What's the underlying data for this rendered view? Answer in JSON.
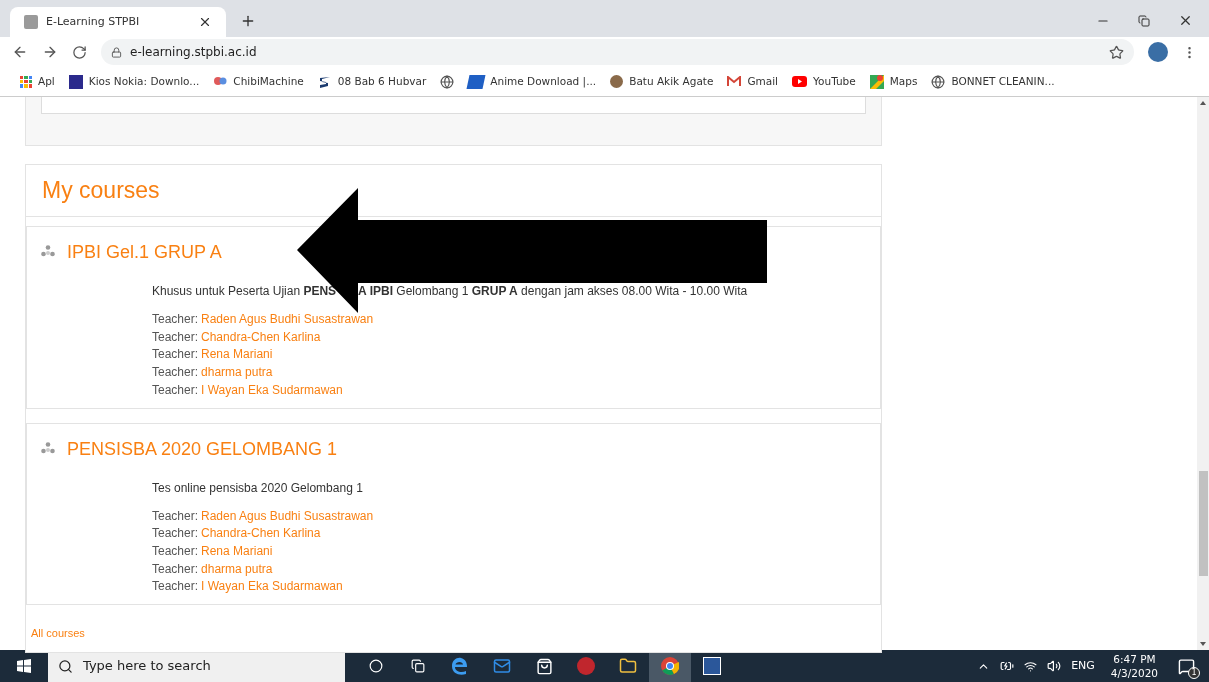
{
  "browser": {
    "tab": {
      "title": "E-Learning STPBI",
      "selected": true
    },
    "address": "e-learning.stpbi.ac.id",
    "bookmarks": [
      {
        "label": "Apl",
        "kind": "apps"
      },
      {
        "label": "Kios Nokia: Downlo...",
        "kind": "n"
      },
      {
        "label": "ChibiMachine",
        "kind": "pin"
      },
      {
        "label": "08 Bab 6 Hubvar",
        "kind": "s"
      },
      {
        "kind": "globe"
      },
      {
        "label": "Anime Download |...",
        "kind": "ae"
      },
      {
        "label": "Batu Akik Agate",
        "kind": "stone"
      },
      {
        "label": "Gmail",
        "kind": "gmail"
      },
      {
        "label": "YouTube",
        "kind": "youtube"
      },
      {
        "label": "Maps",
        "kind": "maps"
      },
      {
        "label": "BONNET CLEANIN...",
        "kind": "globe"
      }
    ]
  },
  "my_courses": {
    "title": "My courses",
    "courses": [
      {
        "title": "IPBI Gel.1 GRUP A",
        "description_parts": [
          "Khusus untuk Peserta Ujian **PENS**",
          "**A IPBI** Gelombang 1 **GRUP A** dengan jam akses 08.00 Wita - 10.00 Wita"
        ],
        "teachers": [
          {
            "label": "Teacher:",
            "name": "Raden Agus Budhi Susastrawan"
          },
          {
            "label": "Teacher:",
            "name": "Chandra-Chen Karlina"
          },
          {
            "label": "Teacher:",
            "name": "Rena Mariani"
          },
          {
            "label": "Teacher:",
            "name": "dharma putra"
          },
          {
            "label": "Teacher:",
            "name": "I Wayan Eka Sudarmawan"
          }
        ]
      },
      {
        "title": "PENSISBA 2020 GELOMBANG 1",
        "description_parts": [
          "Tes online pensisba 2020 Gelombang 1"
        ],
        "teachers": [
          {
            "label": "Teacher:",
            "name": "Raden Agus Budhi Susastrawan"
          },
          {
            "label": "Teacher:",
            "name": "Chandra-Chen Karlina"
          },
          {
            "label": "Teacher:",
            "name": "Rena Mariani"
          },
          {
            "label": "Teacher:",
            "name": "dharma putra"
          },
          {
            "label": "Teacher:",
            "name": "I Wayan Eka Sudarmawan"
          }
        ]
      }
    ],
    "all_courses_link": "All courses"
  },
  "taskbar": {
    "search_placeholder": "Type here to search",
    "language": "ENG",
    "time": "6:47 PM",
    "date": "4/3/2020",
    "notification_count": "1"
  }
}
